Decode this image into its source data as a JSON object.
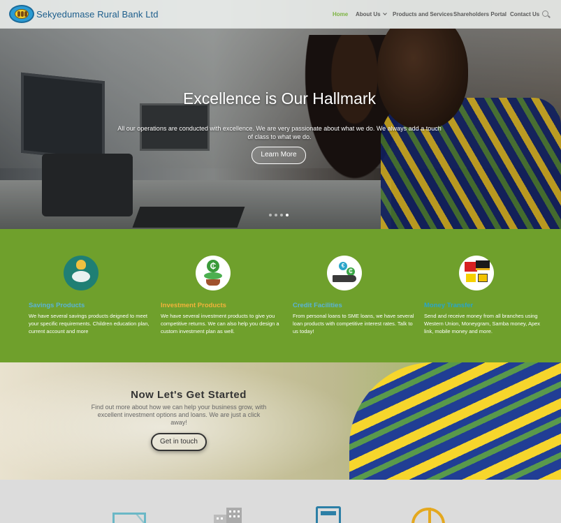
{
  "header": {
    "brand": "Sekyedumase Rural Bank Ltd",
    "nav": {
      "home": "Home",
      "about": "About Us",
      "products": "Products and Services",
      "shareholders": "Shareholders Portal",
      "contact": "Contact Us"
    }
  },
  "hero": {
    "title": "Excellence is Our Hallmark",
    "text": "All our operations are conducted with excellence. We are very passionate about what we do. We always add a touch of class to what we do.",
    "button": "Learn More",
    "slides_total": 4,
    "active_slide": 4
  },
  "services": {
    "background_color": "#6fa02c",
    "items": [
      {
        "title": "Savings Products",
        "title_color": "#5ab3d6",
        "text": "We have several savings products deigned to meet your specific requirements. Children education plan, current account and more",
        "icon": "piggy-bank-icon"
      },
      {
        "title": "Investment Products",
        "title_color": "#f2b23a",
        "text": "We have several investment products to give you competitive returns.  We can also help you design a custom investment plan as well.",
        "icon": "money-plant-icon"
      },
      {
        "title": "Credit Facilities",
        "title_color": "#5ab3d6",
        "text": "From personal loans to SME loans, we have several loan products with competitive interest rates. Talk to us today!",
        "icon": "coins-hand-icon"
      },
      {
        "title": "Money Transfer",
        "title_color": "#2aa5c9",
        "text": "Send and receive money from all branches using Western Union, Moneygram, Samba money, Apex link, mobile money and more.",
        "icon": "money-transfer-logos-icon"
      }
    ]
  },
  "get_started": {
    "title": "Now Let's Get Started",
    "text": "Find out more about how we can help your business grow, with excellent investment options and loans. We are just a click away!",
    "button": "Get in touch"
  },
  "bottom_icons": [
    "envelope-icon",
    "building-icon",
    "calculator-icon",
    "pie-chart-icon"
  ]
}
